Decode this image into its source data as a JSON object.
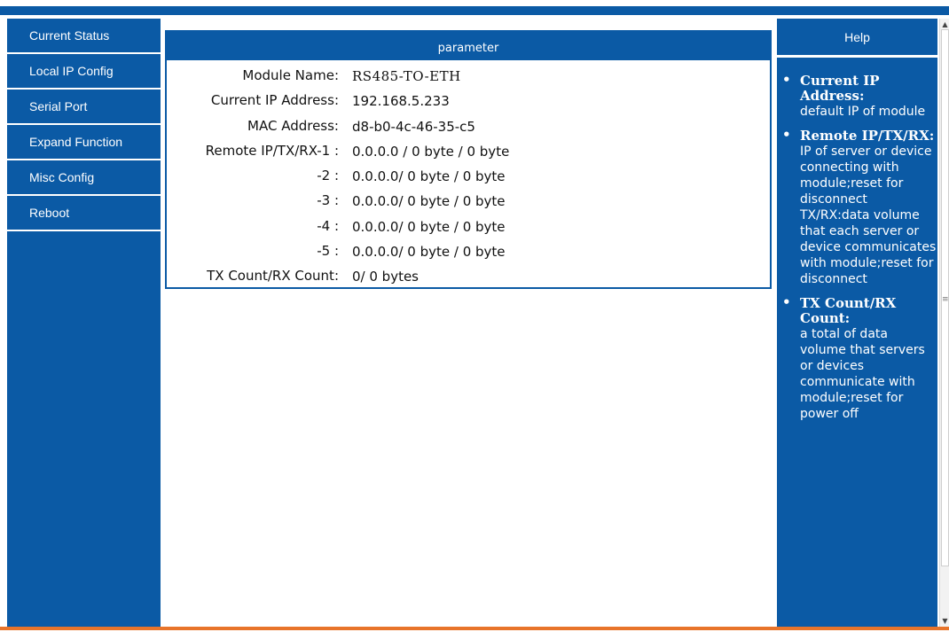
{
  "nav": {
    "items": [
      {
        "label": "Current Status"
      },
      {
        "label": "Local IP Config"
      },
      {
        "label": "Serial Port"
      },
      {
        "label": "Expand Function"
      },
      {
        "label": "Misc Config"
      },
      {
        "label": "Reboot"
      }
    ]
  },
  "parameter": {
    "title": "parameter",
    "rows": [
      {
        "label": "Module Name:",
        "value": "RS485-TO-ETH"
      },
      {
        "label": "Current IP Address:",
        "value": "192.168.5.233"
      },
      {
        "label": "MAC Address:",
        "value": "d8-b0-4c-46-35-c5"
      },
      {
        "label": "Remote IP/TX/RX-1 :",
        "value": "0.0.0.0 / 0 byte / 0 byte"
      },
      {
        "label": "-2 :",
        "value": "0.0.0.0/ 0 byte / 0 byte"
      },
      {
        "label": "-3 :",
        "value": "0.0.0.0/ 0 byte / 0 byte"
      },
      {
        "label": "-4 :",
        "value": "0.0.0.0/ 0 byte / 0 byte"
      },
      {
        "label": "-5 :",
        "value": "0.0.0.0/ 0 byte / 0 byte"
      },
      {
        "label": "TX Count/RX Count:",
        "value": "0/ 0 bytes"
      }
    ]
  },
  "help": {
    "title": "Help",
    "items": [
      {
        "title": "Current IP Address:",
        "text": "default IP of module"
      },
      {
        "title": "Remote IP/TX/RX:",
        "text": "IP of server or device connecting with module;reset for disconnect TX/RX:data volume that each server or device communicates with module;reset for disconnect"
      },
      {
        "title": "TX Count/RX Count:",
        "text": "a total of data volume that servers or devices communicate with module;reset for power off"
      }
    ]
  },
  "colors": {
    "primary_blue": "#0b5aa5",
    "accent_orange": "#e8742a"
  }
}
